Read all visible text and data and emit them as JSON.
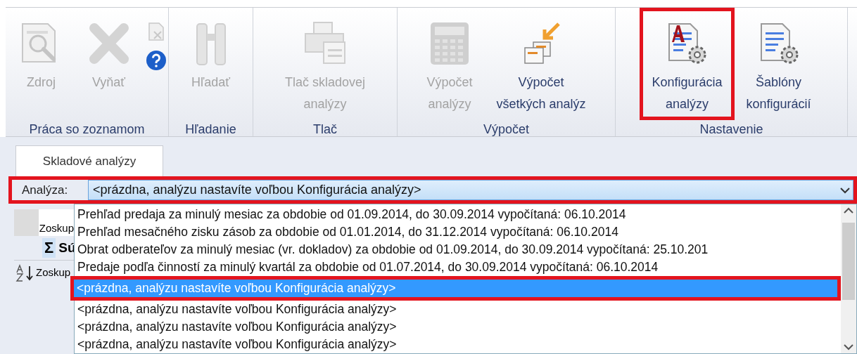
{
  "ribbon": {
    "groups": [
      {
        "label": "Práca so zoznamom",
        "buttons": [
          {
            "lines": [
              "Zdroj"
            ],
            "disabled": true,
            "annotated": false
          },
          {
            "lines": [
              "Vyňať"
            ],
            "disabled": true,
            "annotated": false
          }
        ]
      },
      {
        "label": "Hľadanie",
        "buttons": [
          {
            "lines": [
              "Hľadať"
            ],
            "disabled": true,
            "annotated": false
          }
        ]
      },
      {
        "label": "Tlač",
        "buttons": [
          {
            "lines": [
              "Tlač skladovej",
              "analýzy"
            ],
            "disabled": true,
            "annotated": false
          }
        ]
      },
      {
        "label": "Výpočet",
        "buttons": [
          {
            "lines": [
              "Výpočet",
              "analýzy"
            ],
            "disabled": true,
            "annotated": false
          },
          {
            "lines": [
              "Výpočet",
              "všetkých analýz"
            ],
            "disabled": false,
            "annotated": false
          }
        ]
      },
      {
        "label": "Nastavenie",
        "buttons": [
          {
            "lines": [
              "Konfigurácia",
              "analýzy"
            ],
            "disabled": false,
            "annotated": true
          },
          {
            "lines": [
              "Šablóny",
              "konfigurácií"
            ],
            "disabled": false,
            "annotated": false
          }
        ]
      }
    ]
  },
  "tabs": [
    {
      "label": "Skladové analýzy",
      "selected": true
    }
  ],
  "analysis": {
    "label": "Analýza:",
    "value": "<prázdna, analýzu nastavíte voľbou Konfigurácia analýzy>",
    "annotated": true
  },
  "grid": {
    "group_header": "Zoskup",
    "sum_symbol": "Σ",
    "sum_label": "Sú",
    "sort_header": "Zoskup"
  },
  "dropdown": {
    "items": [
      {
        "text": "Prehľad predaja za minulý mesiac za obdobie od 01.09.2014, do 30.09.2014 vypočítaná: 06.10.2014",
        "selected": false,
        "annotated": false
      },
      {
        "text": "Prehľad mesačného zisku zásob za obdobie od 01.01.2014, do 31.12.2014 vypočítaná: 06.10.2014",
        "selected": false,
        "annotated": false
      },
      {
        "text": "Obrat odberateľov za minulý mesiac (vr. dokladov) za obdobie od 01.09.2014, do 30.09.2014 vypočítaná: 25.10.201",
        "selected": false,
        "annotated": false
      },
      {
        "text": "Predaje podľa činností za minulý kvartál za obdobie od 01.07.2014, do 30.09.2014 vypočítaná: 06.10.2014",
        "selected": false,
        "annotated": false
      },
      {
        "text": "<prázdna, analýzu nastavíte voľbou Konfigurácia analýzy>",
        "selected": true,
        "annotated": true
      },
      {
        "text": "<prázdna, analýzu nastavíte voľbou Konfigurácia analýzy>",
        "selected": false,
        "annotated": false
      },
      {
        "text": "<prázdna, analýzu nastavíte voľbou Konfigurácia analýzy>",
        "selected": false,
        "annotated": false
      },
      {
        "text": "<prázdna, analýzu nastavíte voľbou Konfigurácia analýzy>",
        "selected": false,
        "annotated": false
      }
    ]
  }
}
